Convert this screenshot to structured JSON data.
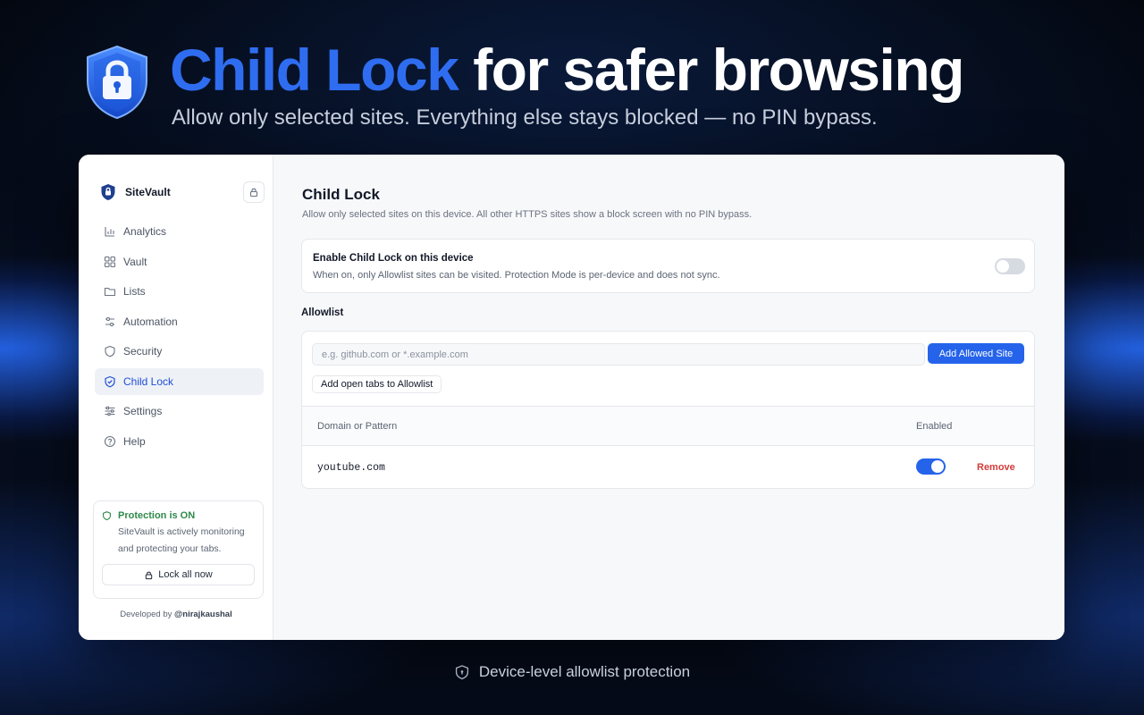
{
  "hero": {
    "title_accent": "Child Lock",
    "title_rest": "for safer browsing",
    "subtitle": "Allow only selected sites. Everything else stays blocked — no PIN bypass.",
    "icon": "shield-lock-icon"
  },
  "sidebar": {
    "brand": "SiteVault",
    "items": [
      {
        "label": "Analytics",
        "icon": "bar-chart-icon",
        "active": false
      },
      {
        "label": "Vault",
        "icon": "grid-icon",
        "active": false
      },
      {
        "label": "Lists",
        "icon": "folder-icon",
        "active": false
      },
      {
        "label": "Automation",
        "icon": "sliders-icon",
        "active": false
      },
      {
        "label": "Security",
        "icon": "shield-icon",
        "active": false
      },
      {
        "label": "Child Lock",
        "icon": "shield-check-icon",
        "active": true
      },
      {
        "label": "Settings",
        "icon": "settings-icon",
        "active": false
      },
      {
        "label": "Help",
        "icon": "help-icon",
        "active": false
      }
    ],
    "status": {
      "title": "Protection is ON",
      "text": "SiteVault is actively monitoring and protecting your tabs.",
      "button": "Lock all now"
    },
    "credit_prefix": "Developed by ",
    "credit_handle": "@nirajkaushal"
  },
  "main": {
    "title": "Child Lock",
    "description": "Allow only selected sites on this device. All other HTTPS sites show a block screen with no PIN bypass.",
    "enable": {
      "title": "Enable Child Lock on this device",
      "description": "When on, only Allowlist sites can be visited. Protection Mode is per-device and does not sync.",
      "enabled": false
    },
    "allowlist": {
      "title": "Allowlist",
      "input_value": "",
      "input_placeholder": "e.g. github.com or *.example.com",
      "add_button": "Add Allowed Site",
      "add_tabs_button": "Add open tabs to Allowlist",
      "columns": {
        "domain": "Domain or Pattern",
        "enabled": "Enabled"
      },
      "rows": [
        {
          "domain": "youtube.com",
          "enabled": true,
          "action": "Remove"
        }
      ]
    }
  },
  "footer": {
    "text": "Device-level allowlist protection",
    "icon": "shield-icon"
  },
  "colors": {
    "accent": "#2f6df0",
    "primary_button": "#2563eb",
    "status_green": "#2f8a4a",
    "danger": "#d43b3b",
    "background": "#02060f"
  }
}
